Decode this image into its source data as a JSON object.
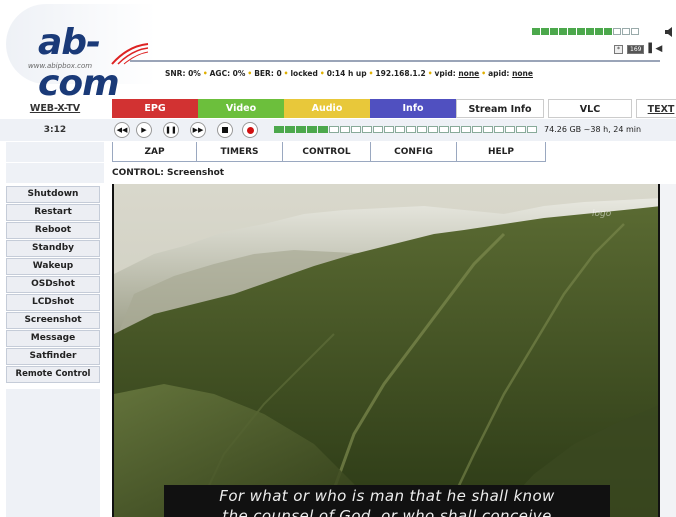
{
  "header": {
    "logo_text": "ab-com",
    "logo_url": "www.abipbox.com",
    "status": {
      "snr": "SNR: 0%",
      "agc": "AGC: 0%",
      "ber": "BER: 0",
      "lock": "locked",
      "uptime": "0:14 h up",
      "ip": "192.168.1.2",
      "vpid_label": "vpid:",
      "vpid_value": "none",
      "apid_label": "apid:",
      "apid_value": "none"
    },
    "signal_level": 0.75,
    "icons": [
      "speaker-icon",
      "teletext-icon",
      "dolby-icon"
    ],
    "tiny_labels": [
      "*",
      "169"
    ]
  },
  "nav": {
    "webtv": "WEB-X-TV",
    "epg": "EPG",
    "video": "Video",
    "audio": "Audio",
    "info": "Info",
    "stream_info": "Stream Info",
    "vlc": "VLC",
    "text": "TEXT"
  },
  "controls": {
    "clock": "3:12",
    "progress": 0.22,
    "disk_info": "74.26 GB ~38 h, 24 min"
  },
  "subtabs": {
    "zap": "ZAP",
    "timers": "TIMERS",
    "control": "CONTROL",
    "config": "CONFIG",
    "help": "HELP"
  },
  "page": {
    "title": "CONTROL: Screenshot"
  },
  "sidebar": {
    "items": [
      {
        "label": "Shutdown"
      },
      {
        "label": "Restart"
      },
      {
        "label": "Reboot"
      },
      {
        "label": "Standby"
      },
      {
        "label": "Wakeup"
      },
      {
        "label": "OSDshot"
      },
      {
        "label": "LCDshot"
      },
      {
        "label": "Screenshot"
      },
      {
        "label": "Message"
      },
      {
        "label": "Satfinder"
      },
      {
        "label": "Remote Control"
      }
    ]
  },
  "screenshot": {
    "subtitle_line1": "For what or who is man that he shall know",
    "subtitle_line2": "the counsel of God, or who shall conceive"
  },
  "colors": {
    "epg": "#d23232",
    "video": "#6cbf3c",
    "audio": "#e8c83a",
    "info": "#5050c0",
    "accent": "#1a3a78"
  }
}
